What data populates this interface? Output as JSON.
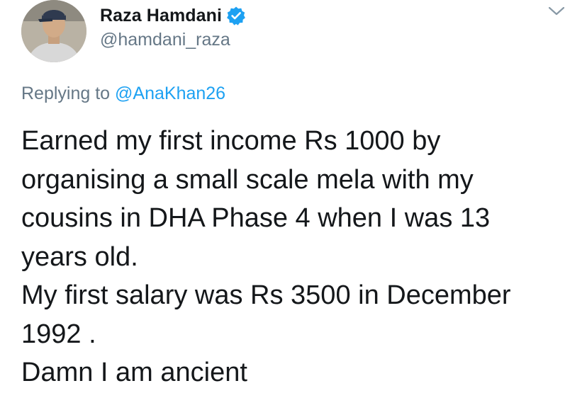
{
  "tweet": {
    "author": {
      "display_name": "Raza Hamdani",
      "handle": "@hamdani_raza",
      "verified": true,
      "avatar_icon": "user-avatar"
    },
    "menu_icon": "chevron-down-icon",
    "reply": {
      "prefix": "Replying to ",
      "mention": "@AnaKhan26"
    },
    "text_lines": [
      "Earned my first income Rs 1000 by",
      "organising a small scale mela with my",
      "cousins in DHA Phase 4 when I was 13",
      "years old.",
      "My first salary was Rs 3500 in December",
      "1992 .",
      "Damn I am ancient"
    ]
  },
  "colors": {
    "text_primary": "#14171a",
    "text_secondary": "#657786",
    "accent": "#1da1f2",
    "background": "#ffffff"
  }
}
